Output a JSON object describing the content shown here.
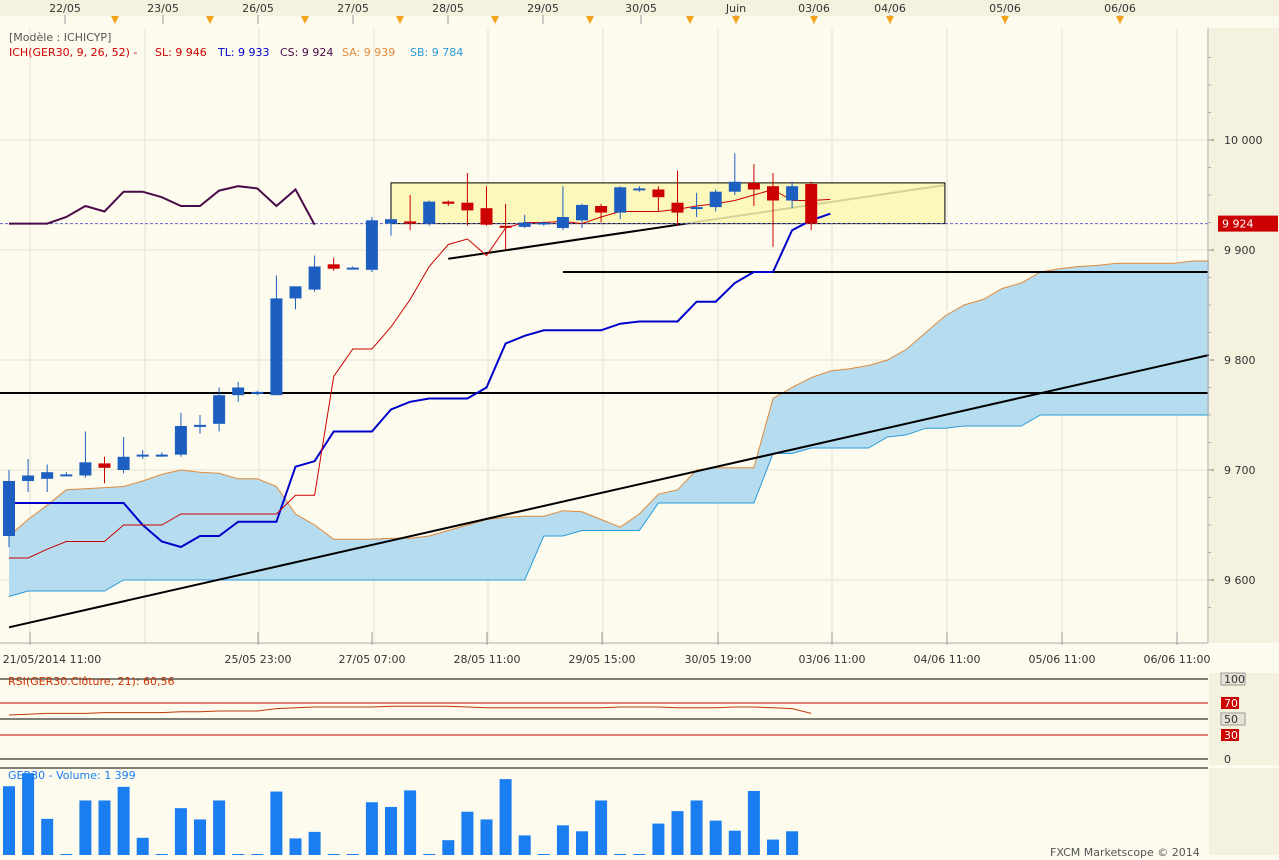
{
  "header": {
    "model_label": "[Modèle : ICHICYP]",
    "ichimoku_label": "ICH(GER30, 9, 26, 52) -",
    "sl_label": "SL: 9 946",
    "tl_label": "TL: 9 933",
    "cs_label": "CS: 9 924",
    "sa_label": "SA: 9 939",
    "sb_label": "SB: 9 784"
  },
  "top_dates": [
    "22/05",
    "23/05",
    "26/05",
    "27/05",
    "28/05",
    "29/05",
    "30/05",
    "Juin",
    "03/06",
    "04/06",
    "05/06",
    "06/06"
  ],
  "price_axis": {
    "ticks": [
      "10 000",
      "9 900",
      "9 800",
      "9 700",
      "9 600"
    ],
    "current_price": "9 924"
  },
  "time_axis": [
    "21/05/2014 11:00",
    "25/05 23:00",
    "27/05 07:00",
    "28/05 11:00",
    "29/05 15:00",
    "30/05 19:00",
    "03/06 11:00",
    "04/06 11:00",
    "05/06 11:00",
    "06/06 11:00"
  ],
  "rsi": {
    "label": "RSI(GER30.Clôture, 21): 60,56",
    "ticks": [
      "100",
      "70",
      "50",
      "30",
      "0"
    ]
  },
  "volume": {
    "label": "GER30 - Volume: 1 399"
  },
  "footer": {
    "copyright": "FXCM Marketscope © 2014"
  },
  "colors": {
    "background": "#fdfbee",
    "bull_candle": "#1c5fc0",
    "bear_candle": "#cc0000",
    "tenkan": "#cc0000",
    "kijun": "#0000cc",
    "chikou": "#4a0a4a",
    "senkou_a": "#e08a3c",
    "senkou_b": "#2a9ad8",
    "cloud": "#b6dcef",
    "volume_bar": "#1a7df0",
    "rsi_line": "#c0390b",
    "current_price_box": "#cc0000"
  },
  "chart_data": [
    {
      "type": "candlestick",
      "title": "GER30",
      "x_unit": "hourly bars",
      "ylim": [
        9550,
        10100
      ],
      "candles": [
        {
          "o": 9640,
          "h": 9700,
          "l": 9630,
          "c": 9690
        },
        {
          "o": 9690,
          "h": 9710,
          "l": 9680,
          "c": 9695
        },
        {
          "o": 9692,
          "h": 9705,
          "l": 9680,
          "c": 9698
        },
        {
          "o": 9695,
          "h": 9698,
          "l": 9695,
          "c": 9696
        },
        {
          "o": 9695,
          "h": 9735,
          "l": 9693,
          "c": 9707
        },
        {
          "o": 9706,
          "h": 9712,
          "l": 9688,
          "c": 9702
        },
        {
          "o": 9700,
          "h": 9730,
          "l": 9697,
          "c": 9712
        },
        {
          "o": 9713,
          "h": 9718,
          "l": 9710,
          "c": 9714
        },
        {
          "o": 9714,
          "h": 9716,
          "l": 9712,
          "c": 9714
        },
        {
          "o": 9714,
          "h": 9752,
          "l": 9712,
          "c": 9740
        },
        {
          "o": 9740,
          "h": 9750,
          "l": 9733,
          "c": 9741
        },
        {
          "o": 9742,
          "h": 9775,
          "l": 9735,
          "c": 9768
        },
        {
          "o": 9768,
          "h": 9780,
          "l": 9762,
          "c": 9775
        },
        {
          "o": 9770,
          "h": 9772,
          "l": 9768,
          "c": 9771
        },
        {
          "o": 9768,
          "h": 9877,
          "l": 9768,
          "c": 9856
        },
        {
          "o": 9856,
          "h": 9866,
          "l": 9846,
          "c": 9867
        },
        {
          "o": 9864,
          "h": 9895,
          "l": 9862,
          "c": 9885
        },
        {
          "o": 9887,
          "h": 9893,
          "l": 9881,
          "c": 9883
        },
        {
          "o": 9884,
          "h": 9885,
          "l": 9883,
          "c": 9884
        },
        {
          "o": 9882,
          "h": 9930,
          "l": 9880,
          "c": 9927
        },
        {
          "o": 9924,
          "h": 9928,
          "l": 9913,
          "c": 9928
        },
        {
          "o": 9926,
          "h": 9950,
          "l": 9918,
          "c": 9924
        },
        {
          "o": 9924,
          "h": 9945,
          "l": 9922,
          "c": 9944
        },
        {
          "o": 9944,
          "h": 9945,
          "l": 9940,
          "c": 9942
        },
        {
          "o": 9943,
          "h": 9970,
          "l": 9922,
          "c": 9936
        },
        {
          "o": 9938,
          "h": 9958,
          "l": 9922,
          "c": 9923
        },
        {
          "o": 9922,
          "h": 9942,
          "l": 9900,
          "c": 9921
        },
        {
          "o": 9921,
          "h": 9932,
          "l": 9920,
          "c": 9925
        },
        {
          "o": 9924,
          "h": 9926,
          "l": 9922,
          "c": 9925
        },
        {
          "o": 9920,
          "h": 9958,
          "l": 9918,
          "c": 9930
        },
        {
          "o": 9927,
          "h": 9942,
          "l": 9920,
          "c": 9941
        },
        {
          "o": 9940,
          "h": 9942,
          "l": 9925,
          "c": 9934
        },
        {
          "o": 9934,
          "h": 9958,
          "l": 9928,
          "c": 9957
        },
        {
          "o": 9955,
          "h": 9958,
          "l": 9953,
          "c": 9956
        },
        {
          "o": 9955,
          "h": 9958,
          "l": 9935,
          "c": 9948
        },
        {
          "o": 9943,
          "h": 9972,
          "l": 9922,
          "c": 9934
        },
        {
          "o": 9938,
          "h": 9952,
          "l": 9930,
          "c": 9939
        },
        {
          "o": 9939,
          "h": 9955,
          "l": 9935,
          "c": 9953
        },
        {
          "o": 9953,
          "h": 9988,
          "l": 9950,
          "c": 9962
        },
        {
          "o": 9961,
          "h": 9978,
          "l": 9940,
          "c": 9955
        },
        {
          "o": 9958,
          "h": 9970,
          "l": 9903,
          "c": 9945
        },
        {
          "o": 9945,
          "h": 9962,
          "l": 9938,
          "c": 9958
        },
        {
          "o": 9960,
          "h": 9962,
          "l": 9918,
          "c": 9924
        }
      ],
      "tenkan_sen": [
        9620,
        9620,
        9628,
        9635,
        9635,
        9635,
        9650,
        9650,
        9650,
        9660,
        9660,
        9660,
        9660,
        9660,
        9660,
        9677,
        9677,
        9785,
        9810,
        9810,
        9830,
        9855,
        9885,
        9905,
        9910,
        9895,
        9920,
        9925,
        9925,
        9926,
        9924,
        9930,
        9935,
        9935,
        9935,
        9937,
        9940,
        9942,
        9945,
        9950,
        9955,
        9945,
        9945,
        9946
      ],
      "kijun_sen": [
        9670,
        9670,
        9670,
        9670,
        9670,
        9670,
        9670,
        9650,
        9635,
        9630,
        9640,
        9640,
        9653,
        9653,
        9653,
        9703,
        9708,
        9735,
        9735,
        9735,
        9755,
        9762,
        9765,
        9765,
        9765,
        9775,
        9815,
        9822,
        9827,
        9827,
        9827,
        9827,
        9833,
        9835,
        9835,
        9835,
        9853,
        9853,
        9870,
        9880,
        9880,
        9918,
        9927,
        9933
      ],
      "chikou_span": [
        9924,
        9924,
        9924,
        9930,
        9940,
        9935,
        9953,
        9953,
        9948,
        9940,
        9940,
        9954,
        9958,
        9956,
        9940,
        9955,
        9923
      ],
      "senkou_span_a": [
        9640,
        9655,
        9668,
        9682,
        9683,
        9684,
        9685,
        9690,
        9696,
        9700,
        9698,
        9697,
        9692,
        9692,
        9685,
        9660,
        9650,
        9637,
        9637,
        9637,
        9638,
        9638,
        9640,
        9645,
        9650,
        9655,
        9657,
        9658,
        9658,
        9663,
        9662,
        9655,
        9648,
        9660,
        9678,
        9682,
        9700,
        9702,
        9702,
        9702,
        9765,
        9775,
        9784,
        9790,
        9792,
        9795,
        9800,
        9810,
        9825,
        9840,
        9850,
        9855,
        9865,
        9870,
        9880,
        9883,
        9885,
        9886,
        9888,
        9888,
        9888,
        9888,
        9890,
        9890,
        9890,
        9898,
        9905
      ],
      "senkou_span_b": [
        9585,
        9590,
        9590,
        9590,
        9590,
        9590,
        9600,
        9600,
        9600,
        9600,
        9600,
        9600,
        9600,
        9600,
        9600,
        9600,
        9600,
        9600,
        9600,
        9600,
        9600,
        9600,
        9600,
        9600,
        9600,
        9600,
        9600,
        9600,
        9640,
        9640,
        9645,
        9645,
        9645,
        9645,
        9670,
        9670,
        9670,
        9670,
        9670,
        9670,
        9715,
        9715,
        9720,
        9720,
        9720,
        9720,
        9730,
        9732,
        9738,
        9738,
        9740,
        9740,
        9740,
        9740,
        9750,
        9750,
        9750,
        9750,
        9750,
        9750,
        9750,
        9750,
        9750,
        9750,
        9750,
        9750,
        9750
      ],
      "horizontal_lines": [
        9770,
        9880
      ],
      "trendlines": [
        {
          "from": [
            0,
            9557
          ],
          "to": [
            67,
            9821
          ]
        },
        {
          "from": [
            23,
            9892
          ],
          "to": [
            49,
            9959
          ]
        }
      ],
      "consolidation_box": {
        "from_bar": 20,
        "to_bar": 49,
        "low": 9924,
        "high": 9961
      },
      "current_price": 9924
    },
    {
      "type": "line",
      "title": "RSI(GER30.Clôture, 21): 60,56",
      "ylim": [
        0,
        100
      ],
      "levels": [
        70,
        50,
        30
      ],
      "values": [
        55,
        56,
        57,
        57,
        57,
        58,
        58,
        58,
        58,
        59,
        59,
        60,
        60,
        60,
        63,
        64,
        65,
        65,
        65,
        65,
        66,
        66,
        66,
        66,
        65,
        64,
        64,
        64,
        64,
        64,
        64,
        64,
        65,
        65,
        65,
        64,
        64,
        64,
        65,
        65,
        64,
        63,
        57
      ]
    },
    {
      "type": "bar",
      "title": "GER30 - Volume: 1 399",
      "values": [
        1160,
        1380,
        610,
        0,
        920,
        920,
        1150,
        290,
        0,
        790,
        600,
        920,
        0,
        0,
        1070,
        280,
        390,
        0,
        0,
        890,
        810,
        1090,
        0,
        250,
        730,
        600,
        1280,
        330,
        0,
        500,
        400,
        920,
        0,
        0,
        530,
        740,
        920,
        580,
        410,
        1080,
        260,
        400
      ]
    }
  ]
}
